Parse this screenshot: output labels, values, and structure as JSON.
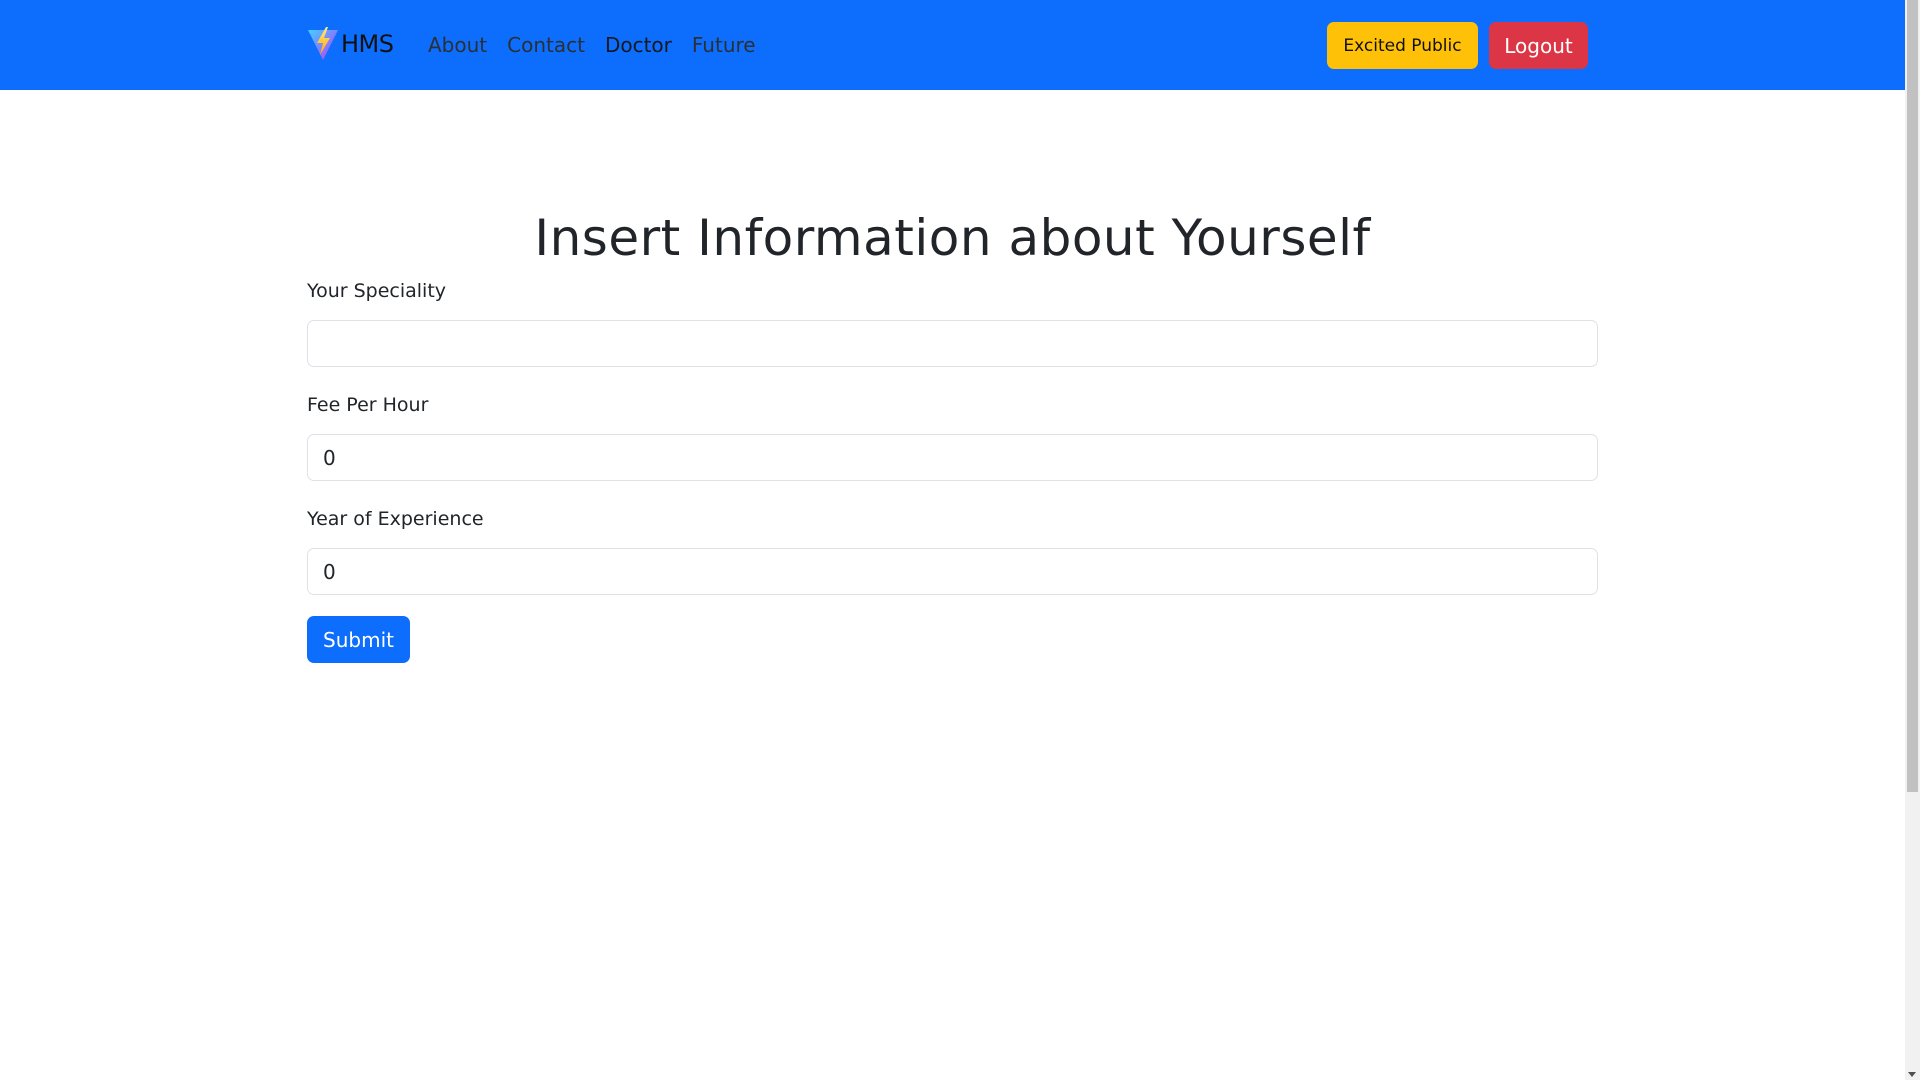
{
  "navbar": {
    "brand_icon": "lightning-bolt-icon",
    "brand_text": "HMS",
    "links": [
      {
        "label": "About"
      },
      {
        "label": "Contact"
      },
      {
        "label": "Doctor"
      },
      {
        "label": "Future"
      }
    ],
    "user_label": "Excited Public",
    "logout_label": "Logout",
    "colors": {
      "bar": "#0d6efd",
      "user_button": "#ffc107",
      "logout_button": "#dc3545"
    }
  },
  "main": {
    "title": "Insert Information about Yourself",
    "fields": [
      {
        "label": "Your Speciality",
        "value": ""
      },
      {
        "label": "Fee Per Hour",
        "value": "0"
      },
      {
        "label": "Year of Experience",
        "value": "0"
      }
    ],
    "submit_label": "Submit"
  }
}
